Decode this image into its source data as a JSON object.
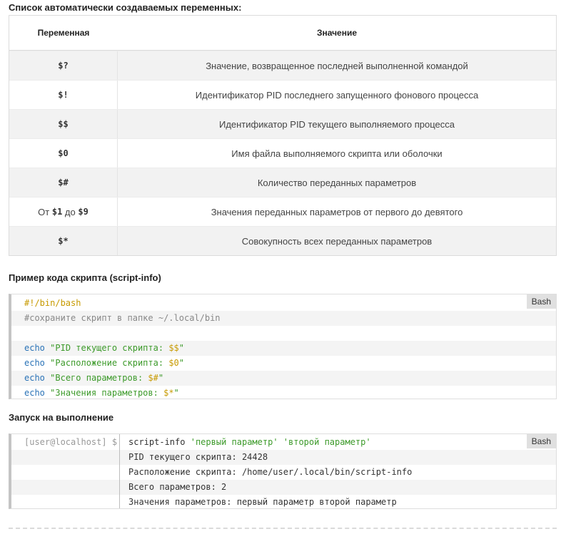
{
  "section1_title": "Список автоматически создаваемых переменных:",
  "table": {
    "headers": {
      "variable": "Переменная",
      "value": "Значение"
    },
    "rows": [
      {
        "var": "$?",
        "desc": "Значение, возвращенное последней выполненной командой"
      },
      {
        "var": "$!",
        "desc": "Идентификатор PID последнего запущенного фонового процесса"
      },
      {
        "var": "$$",
        "desc": "Идентификатор PID текущего выполняемого процесса"
      },
      {
        "var": "$0",
        "desc": "Имя файла выполняемого скрипта или оболочки"
      },
      {
        "var": "$#",
        "desc": "Количество переданных параметров"
      },
      {
        "var_prefix": "От ",
        "var": "$1",
        "var_mid": " до ",
        "var2": "$9",
        "desc": "Значения переданных параметров от первого до девятого"
      },
      {
        "var": "$*",
        "desc": "Совокупность всех переданных параметров"
      }
    ]
  },
  "section2_title": "Пример кода скрипта (script-info)",
  "script_block": {
    "lang": "Bash",
    "shebang": "#!/bin/bash",
    "comment": "#сохраните скрипт в папке ~/.local/bin",
    "blank": "",
    "lines": [
      {
        "kw": "echo",
        "str": "\"PID текущего скрипта: ",
        "var": "$$",
        "end": "\""
      },
      {
        "kw": "echo",
        "str": "\"Расположение скрипта: ",
        "var": "$0",
        "end": "\""
      },
      {
        "kw": "echo",
        "str": "\"Всего параметров: ",
        "var": "$#",
        "end": "\""
      },
      {
        "kw": "echo",
        "str": "\"Значения параметров: ",
        "var": "$*",
        "end": "\""
      }
    ]
  },
  "section3_title": "Запуск на выполнение",
  "run_block": {
    "lang": "Bash",
    "prompt": "[user@localhost] $",
    "command": "script-info",
    "arg1": "'первый параметр'",
    "arg2": "'второй параметр'",
    "output": [
      "PID текущего скрипта: 24428",
      "Расположение скрипта: /home/user/.local/bin/script-info",
      "Всего параметров: 2",
      "Значения параметров: первый параметр второй параметр"
    ]
  }
}
